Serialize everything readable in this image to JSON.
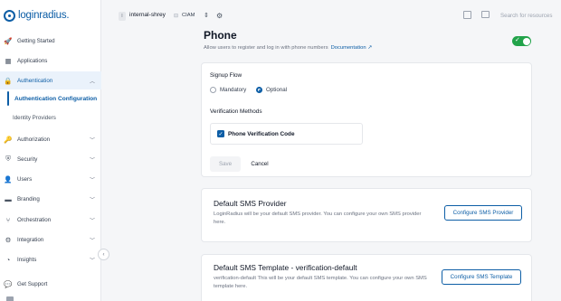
{
  "brand": {
    "logo_text": "loginradius.",
    "accent": "#0d5ea6",
    "toggle_color": "#22a34a"
  },
  "sidebar": {
    "items": [
      {
        "label": "Getting Started",
        "icon": "rocket-icon"
      },
      {
        "label": "Applications",
        "icon": "grid-icon"
      },
      {
        "label": "Authentication",
        "icon": "lock-icon"
      },
      {
        "label": "Authorization",
        "icon": "key-icon"
      },
      {
        "label": "Security",
        "icon": "shield-icon"
      },
      {
        "label": "Users",
        "icon": "users-icon"
      },
      {
        "label": "Branding",
        "icon": "brush-icon"
      },
      {
        "label": "Orchestration",
        "icon": "flow-icon"
      },
      {
        "label": "Integration",
        "icon": "puzzle-icon"
      },
      {
        "label": "Insights",
        "icon": "pie-chart-icon"
      }
    ],
    "sub_items": [
      {
        "label": "Authentication Configuration"
      },
      {
        "label": "Identity Providers"
      }
    ],
    "get_support": "Get Support"
  },
  "topbar": {
    "app_badge": "I",
    "app_name": "internal-shrey",
    "env_name": "CIAM",
    "search_placeholder": "Search for resources"
  },
  "page": {
    "title": "Phone",
    "subtitle": "Allow users to register and log in with phone numbers",
    "doc_link": "Documentation ↗",
    "enabled": true
  },
  "signup": {
    "label": "Signup Flow",
    "options": [
      "Mandatory",
      "Optional"
    ],
    "selected": "Optional",
    "verif_label": "Verification Methods",
    "verif_option": "Phone Verification Code",
    "verif_checked": true,
    "save": "Save",
    "cancel": "Cancel"
  },
  "sms_provider": {
    "title": "Default SMS Provider",
    "desc": "LoginRadius will be your default SMS provider. You can configure your own SMS provider here.",
    "button": "Configure SMS Provider"
  },
  "sms_template": {
    "title": "Default SMS Template - verification-default",
    "desc": "verification-default This will be your default SMS template. You can configure your own SMS template here.",
    "button": "Configure SMS Template"
  }
}
